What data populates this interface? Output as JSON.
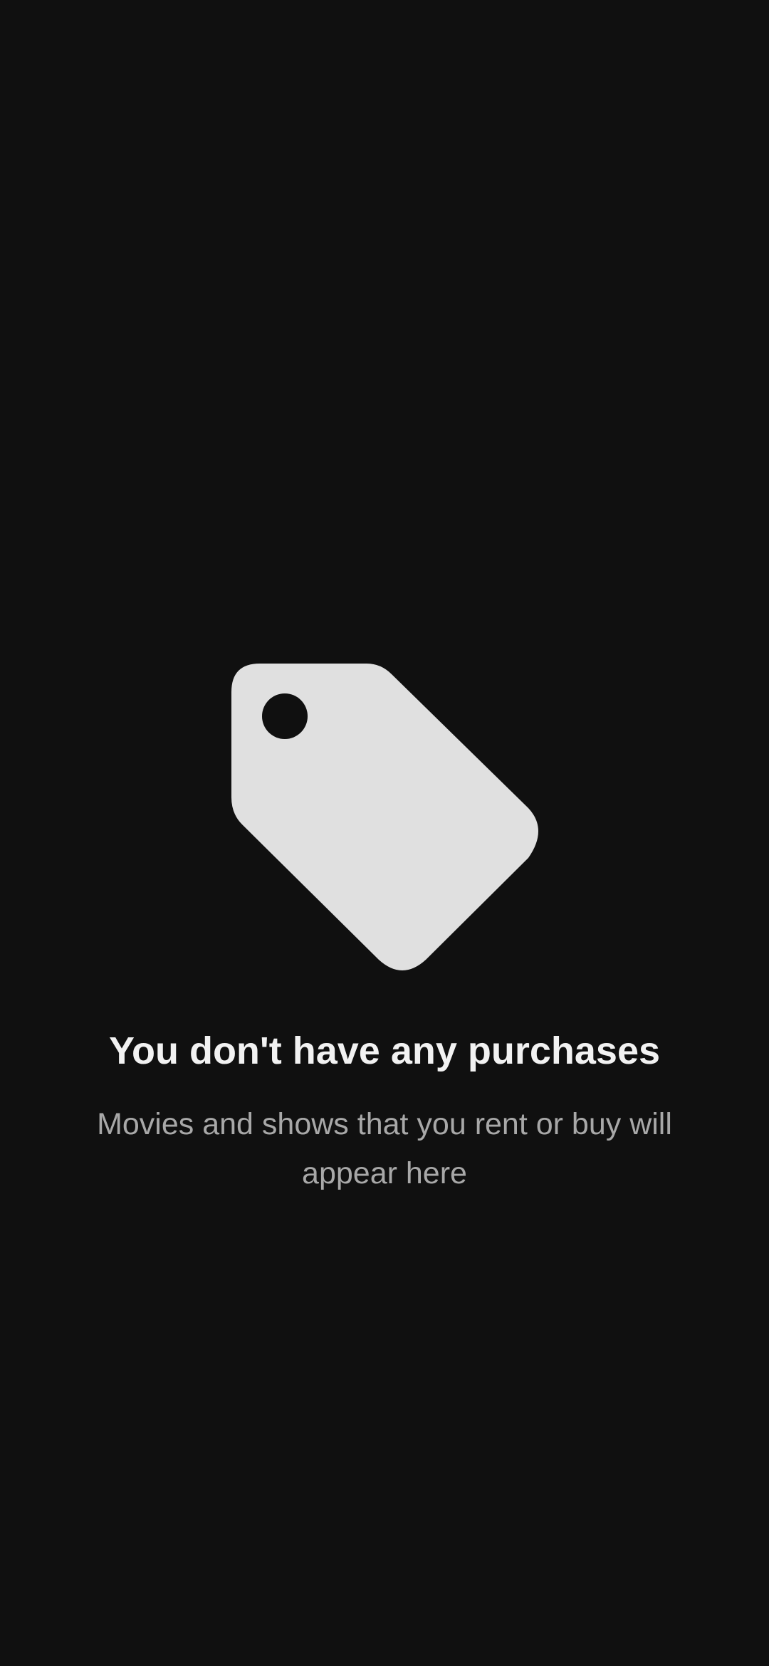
{
  "empty_state": {
    "icon": "price-tag-icon",
    "title": "You don't have any purchases",
    "subtitle": "Movies and shows that you rent or buy will appear here"
  },
  "colors": {
    "background": "#101010",
    "icon": "#e0e0e0",
    "title": "#f2f2f2",
    "subtitle": "#a8a8a8"
  }
}
